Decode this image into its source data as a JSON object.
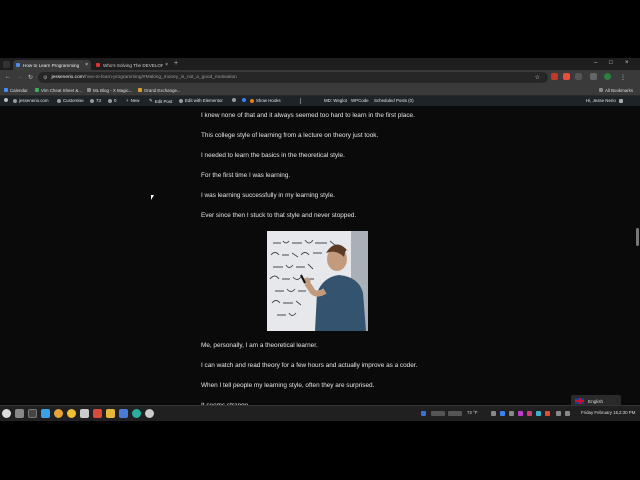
{
  "tabs": [
    {
      "label": "How to Learn Programming",
      "active": true,
      "favicon_color": "#4a8cf0"
    },
    {
      "label": "Who's Solving The DEVELOPER",
      "active": false,
      "favicon_color": "#e03030"
    }
  ],
  "toolbar": {
    "url_host": "jessenerio.com",
    "url_path": "/how-to-learn-programming/#Making_money_is_not_a_good_motivation"
  },
  "bookmarks": [
    {
      "label": "Calendar",
      "color": "#4a8cf0"
    },
    {
      "label": "Vim Cheat Sheet &...",
      "color": "#3cab5c"
    },
    {
      "label": "ML Blog - X Magic...",
      "color": "#8a8a8a"
    },
    {
      "label": "Grand Exchange...",
      "color": "#d6a030"
    }
  ],
  "all_bookmarks": "All Bookmarks",
  "admin_bar": {
    "site_name": "jessenerio.com",
    "customise": "Customise",
    "updates": "73",
    "comments": "0",
    "new": "New",
    "edit_post": "Edit Post",
    "edit_elementor": "Edit with Elementor",
    "show_hooks": "Show Hooks",
    "weglot": "MD: Weglot",
    "wpcode": "WPCode",
    "scheduled": "Scheduled Posts (0)",
    "greeting": "Hi, Jesse Nerio"
  },
  "paragraphs": [
    "I knew none of that and it always seemed too hard to learn in the first place.",
    "This college style of learning from a lecture on theory just took.",
    "I needed to learn the basics in the theoretical style.",
    "For the first time I was learning.",
    "I was learning successfully in my learning style.",
    "Ever since then I stuck to that style and never stopped.",
    "Me, personally, I am a theoretical learner.",
    "I can watch and read theory for a few hours and actually improve as a coder.",
    "When I tell people my learning style, often they are surprised.",
    "It seems strange."
  ],
  "language_switcher": "English",
  "taskbar": {
    "weather": "72 °F",
    "date": "Friday February 16,",
    "time": "2:30 PM"
  }
}
